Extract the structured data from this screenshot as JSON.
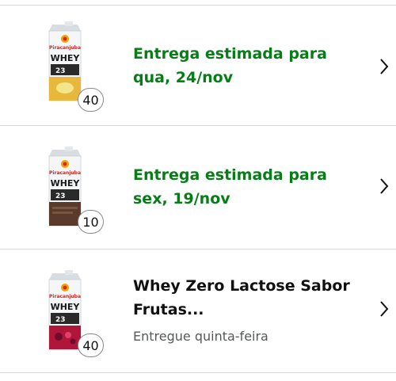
{
  "orders": [
    {
      "product_brand": "Piracanjuba",
      "product_line": "WHEY",
      "product_protein": "23",
      "flavor_color": "#e8b83c",
      "quantity": "40",
      "status_line": "Entrega estimada para\nqua, 24/nov",
      "status_color": "#067d16",
      "icon": "chevron-right-icon"
    },
    {
      "product_brand": "Piracanjuba",
      "product_line": "WHEY",
      "product_protein": "23",
      "flavor_color": "#5a3a2a",
      "quantity": "10",
      "status_line": "Entrega estimada para\nsex, 19/nov",
      "status_color": "#067d16",
      "icon": "chevron-right-icon"
    },
    {
      "product_brand": "Piracanjuba",
      "product_line": "WHEY",
      "product_protein": "23",
      "flavor_color": "#b0153a",
      "quantity": "40",
      "product_title": "Whey Zero Lactose Sabor\nFrutas...",
      "delivery_note": "Entregue quinta-feira",
      "icon": "chevron-right-icon"
    }
  ]
}
